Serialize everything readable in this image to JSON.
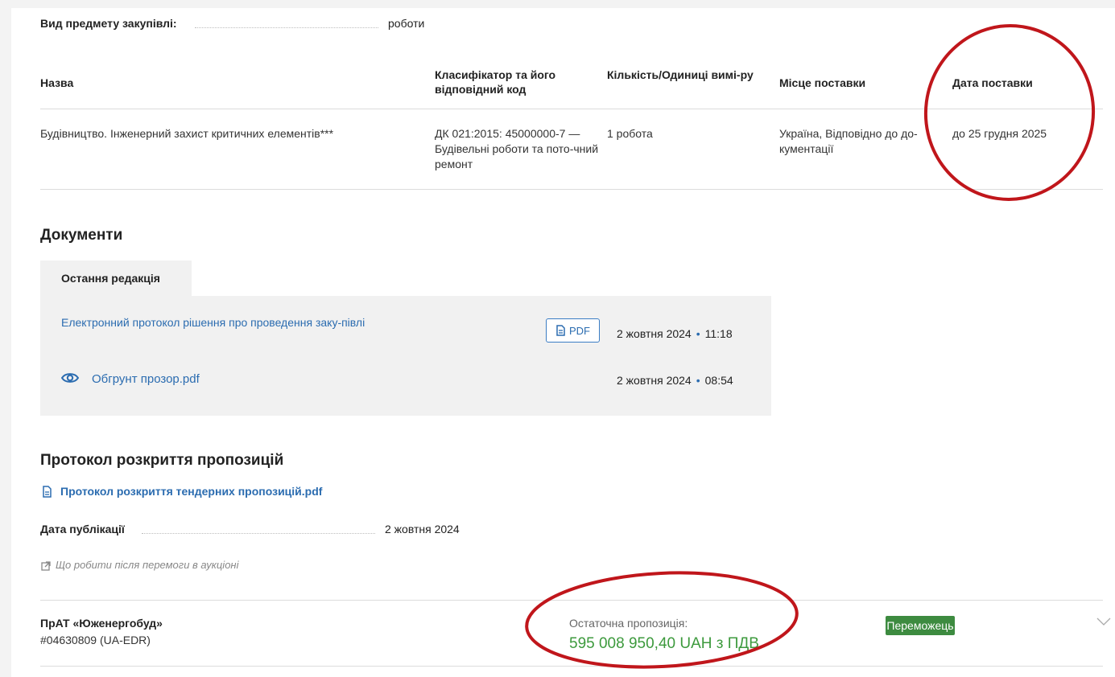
{
  "procurement": {
    "type_label": "Вид предмету закупівлі:",
    "type_value": "роботи"
  },
  "items_table": {
    "headers": {
      "name": "Назва",
      "classifier": "Класифікатор та його відповідний код",
      "quantity": "Кількість/Одиниці вимі-ру",
      "place": "Місце поставки",
      "date": "Дата поставки"
    },
    "rows": [
      {
        "name": "Будівництво. Інженерний захист критичних елементів***",
        "classifier": "ДК 021:2015: 45000000-7 — Будівельні роботи та пото-чний ремонт",
        "quantity": "1 робота",
        "place": "Україна, Відповідно до до-кументації",
        "date": "до  25 грудня 2025"
      }
    ]
  },
  "documents": {
    "title": "Документи",
    "tab_label": "Остання редакція",
    "items": [
      {
        "name": "Електронний протокол рішення про проведення заку-півлі",
        "badge": "PDF",
        "date": "2 жовтня 2024",
        "time": "11:18"
      },
      {
        "name": "Обгрунт прозор.pdf",
        "date": "2 жовтня 2024",
        "time": "08:54"
      }
    ]
  },
  "opening_protocol": {
    "title": "Протокол розкриття пропозицій",
    "file_link": "Протокол розкриття тендерних пропозицій.pdf",
    "pub_date_label": "Дата публікації",
    "pub_date_value": "2 жовтня 2024",
    "after_win_link": "Що робити після перемоги в аукціоні"
  },
  "bidder": {
    "name": "ПрАТ «Юженергобуд»",
    "id": "#04630809 (UA-EDR)",
    "final_label": "Остаточна пропозиція:",
    "final_amount": "595 008 950,40 UAH з ПДВ",
    "status": "Переможець"
  },
  "colors": {
    "link": "#2b6cb0",
    "winner": "#3d8b40",
    "amount": "#3d9a3d",
    "annotation": "#c0161b"
  }
}
